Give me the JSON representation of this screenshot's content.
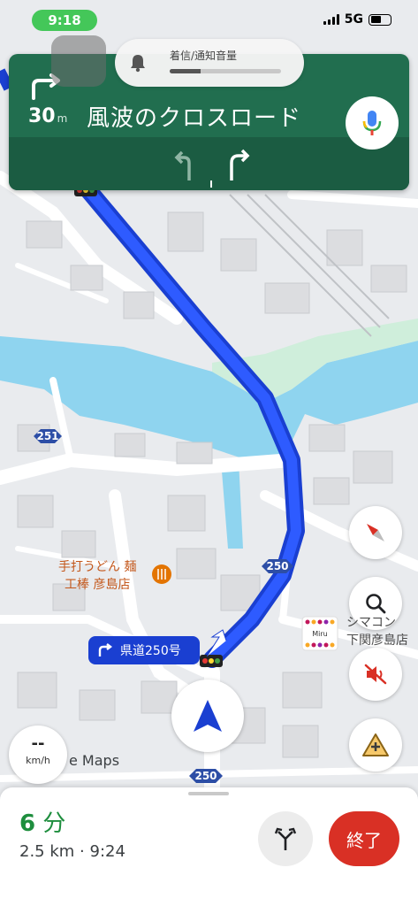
{
  "status_bar": {
    "time": "9:18",
    "network": "5G"
  },
  "volume_toast": {
    "label": "着信/通知音量",
    "level": 0.28
  },
  "navigation": {
    "distance": "30",
    "distance_unit": "m",
    "street": "風波のクロスロード",
    "maneuver": "turn-right"
  },
  "map": {
    "route_shields": [
      "250",
      "250",
      "250",
      "251"
    ],
    "maneuver_label": "県道250号",
    "poi_restaurant": [
      "手打うどん 麺",
      "工棒 彦島店"
    ],
    "poi_store": [
      "シマコン",
      "下関彦島店"
    ],
    "poi_store_logo": "Miru",
    "watermark": "e Maps"
  },
  "speed": {
    "value": "--",
    "unit": "km/h"
  },
  "trip": {
    "eta_value": "6",
    "eta_unit": "分",
    "distance": "2.5 km",
    "separator": "·",
    "arrival": "9:24",
    "end_label": "終了"
  },
  "colors": {
    "nav_green": "#216e4f",
    "route_blue": "#1a3fd1",
    "water": "#8fd4ef",
    "end_red": "#d93025",
    "eta_green": "#1e8e3e"
  }
}
